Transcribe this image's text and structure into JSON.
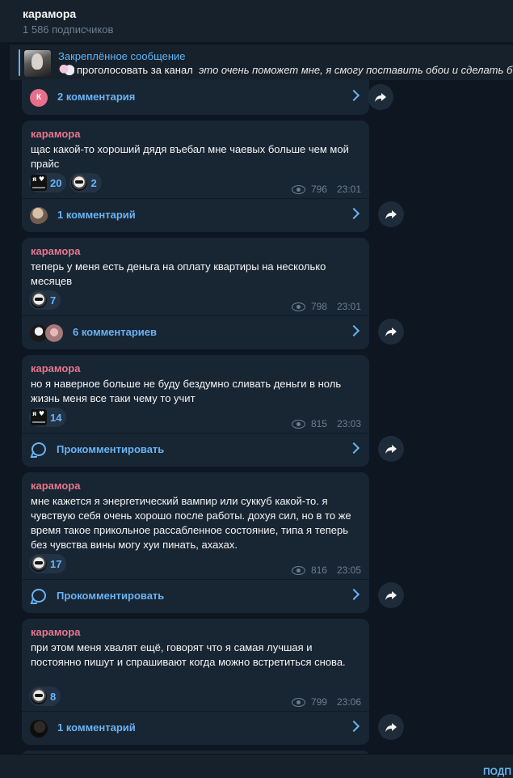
{
  "header": {
    "title": "карамора",
    "subscribers": "1 586 подписчиков"
  },
  "pinned": {
    "title": "Закреплённое сообщение",
    "text_plain": "проголосовать за канал",
    "text_italic": "это очень поможет мне, я смогу поставить обои и сделать б"
  },
  "top_comments": {
    "label": "2 комментария",
    "avatar_letter": "К"
  },
  "posts": [
    {
      "author": "карамора",
      "text": "щас какой-то хороший дядя въебал мне чаевых больше чем мой прайс",
      "reactions": [
        {
          "icon": "love-sticker-icon",
          "count": "20"
        },
        {
          "icon": "skull-sticker-icon",
          "count": "2"
        }
      ],
      "views": "796",
      "time": "23:01",
      "comments": "1 комментарий"
    },
    {
      "author": "карамора",
      "text": "теперь у меня есть деньга на оплату квартиры на несколько месяцев",
      "reactions": [
        {
          "icon": "skull-sticker-icon",
          "count": "7"
        }
      ],
      "views": "798",
      "time": "23:01",
      "comments": "6 комментариев"
    },
    {
      "author": "карамора",
      "text": "но я наверное больше не буду бездумно сливать деньги в ноль жизнь меня все таки чему то учит",
      "reactions": [
        {
          "icon": "love-sticker-icon",
          "count": "14"
        }
      ],
      "views": "815",
      "time": "23:03",
      "comments": "Прокомментировать"
    },
    {
      "author": "карамора",
      "text": "мне кажется я энергетический вампир или суккуб какой-то. я чувствую себя очень хорошо после работы. дохуя сил, но в то же время такое прикольное рассабленное состояние, типа я теперь без чувства вины могу хуи пинать, ахахах.",
      "reactions": [
        {
          "icon": "skull-sticker-icon",
          "count": "17"
        }
      ],
      "views": "816",
      "time": "23:05",
      "comments": "Прокомментировать"
    },
    {
      "author": "карамора",
      "text": "при этом меня хвалят ещё, говорят что я самая лучшая и постоянно пишут и спрашивают когда можно встретиться снова.",
      "reactions": [
        {
          "icon": "skull-sticker-icon",
          "count": "8"
        }
      ],
      "views": "799",
      "time": "23:06",
      "comments": "1 комментарий"
    }
  ],
  "bottom": {
    "subscribe_label": "ПОДП"
  }
}
